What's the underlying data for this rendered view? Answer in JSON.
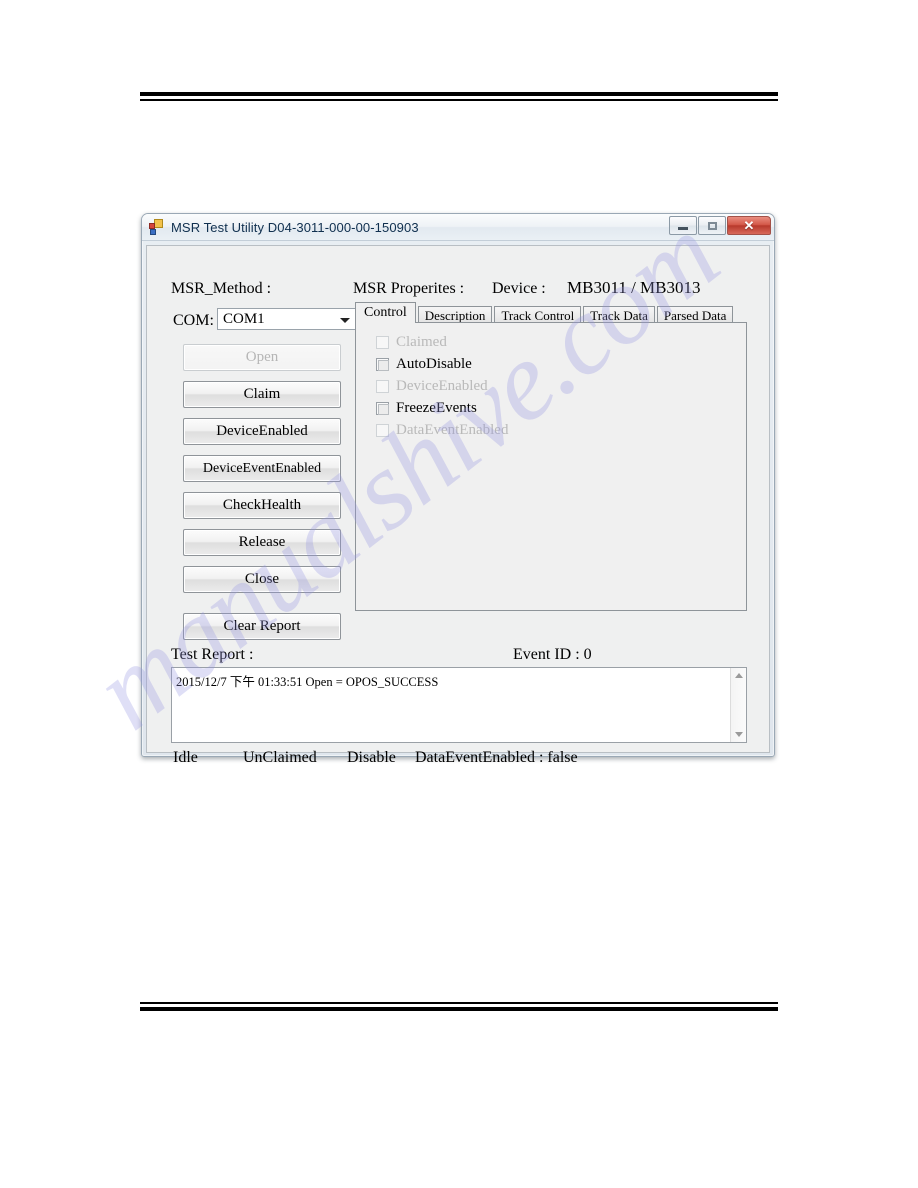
{
  "page": {
    "watermark": "manualshive.com"
  },
  "window": {
    "title": "MSR Test Utility D04-3011-000-00-150903",
    "icon": "app-icon",
    "controls": {
      "minimize": "–",
      "maximize": "□",
      "close": "✕"
    }
  },
  "left_panel": {
    "method_label": "MSR_Method :",
    "com_label": "COM:",
    "com_value": "COM1",
    "com_options": [
      "COM1"
    ],
    "buttons": [
      {
        "label": "Open",
        "enabled": false
      },
      {
        "label": "Claim",
        "enabled": true
      },
      {
        "label": "DeviceEnabled",
        "enabled": true
      },
      {
        "label": "DeviceEventEnabled",
        "enabled": true
      },
      {
        "label": "CheckHealth",
        "enabled": true
      },
      {
        "label": "Release",
        "enabled": true
      },
      {
        "label": "Close",
        "enabled": true
      },
      {
        "label": "Clear Report",
        "enabled": true
      }
    ]
  },
  "right_panel": {
    "properties_label": "MSR Properites :",
    "device_label": "Device :",
    "device_value": "MB3011 / MB3013",
    "tabs": [
      {
        "label": "Control",
        "active": true
      },
      {
        "label": "Description",
        "active": false
      },
      {
        "label": "Track Control",
        "active": false
      },
      {
        "label": "Track Data",
        "active": false
      },
      {
        "label": "Parsed Data",
        "active": false
      }
    ],
    "checkboxes": [
      {
        "label": "Claimed",
        "checked": false,
        "enabled": false
      },
      {
        "label": "AutoDisable",
        "checked": true,
        "enabled": true
      },
      {
        "label": "DeviceEnabled",
        "checked": false,
        "enabled": false
      },
      {
        "label": "FreezeEvents",
        "checked": true,
        "enabled": true
      },
      {
        "label": "DataEventEnabled",
        "checked": false,
        "enabled": false
      }
    ]
  },
  "report": {
    "label": "Test Report :",
    "event_id_label": "Event ID : 0",
    "lines": [
      "2015/12/7 下午 01:33:51  Open = OPOS_SUCCESS"
    ]
  },
  "status_bar": {
    "state": "Idle",
    "claim_state": "UnClaimed",
    "device_state": "Disable",
    "data_event": "DataEventEnabled : false"
  }
}
